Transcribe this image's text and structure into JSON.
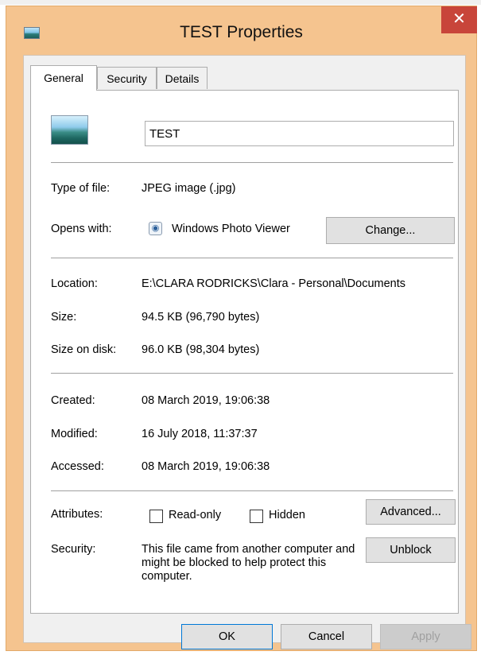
{
  "window": {
    "title": "TEST Properties",
    "close_glyph": "✕",
    "icon": "image-file-icon"
  },
  "tabs": [
    {
      "label": "General",
      "active": true
    },
    {
      "label": "Security",
      "active": false
    },
    {
      "label": "Details",
      "active": false
    }
  ],
  "file": {
    "name": "TEST",
    "icon": "jpeg-thumbnail-icon"
  },
  "type_section": {
    "type_label": "Type of file:",
    "type_value": "JPEG image (.jpg)",
    "opens_label": "Opens with:",
    "opens_value": "Windows Photo Viewer",
    "opens_icon": "photo-viewer-icon",
    "change_button": "Change..."
  },
  "location_section": {
    "location_label": "Location:",
    "location_value": "E:\\CLARA RODRICKS\\Clara - Personal\\Documents",
    "size_label": "Size:",
    "size_value": "94.5 KB (96,790 bytes)",
    "size_on_disk_label": "Size on disk:",
    "size_on_disk_value": "96.0 KB (98,304 bytes)"
  },
  "dates_section": {
    "created_label": "Created:",
    "created_value": "08 March 2019, 19:06:38",
    "modified_label": "Modified:",
    "modified_value": "16 July 2018, 11:37:37",
    "accessed_label": "Accessed:",
    "accessed_value": "08 March 2019, 19:06:38"
  },
  "attributes_section": {
    "attributes_label": "Attributes:",
    "readonly_label": "Read-only",
    "readonly_checked": false,
    "hidden_label": "Hidden",
    "hidden_checked": false,
    "advanced_button": "Advanced...",
    "security_label": "Security:",
    "security_text": "This file came from another computer and might be blocked to help protect this computer.",
    "unblock_button": "Unblock"
  },
  "footer": {
    "ok": "OK",
    "cancel": "Cancel",
    "apply": "Apply"
  },
  "colors": {
    "title_bar": "#f5c48f",
    "close_button": "#c8453a",
    "panel": "#ffffff",
    "dialog_face": "#f0f0f0"
  }
}
